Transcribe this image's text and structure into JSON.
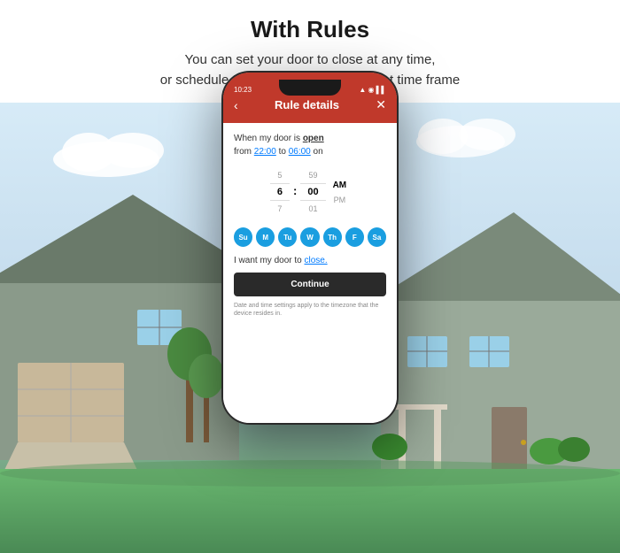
{
  "header": {
    "title": "With Rules",
    "subtitle_line1": "You can set your door to close at any time,",
    "subtitle_line2": "or schedule the door to close after a set time frame"
  },
  "phone": {
    "status_time": "10:23",
    "nav": {
      "back_icon": "‹",
      "close_icon": "✕"
    },
    "screen_title": "Rule details",
    "rule_text_1": "When my door is ",
    "rule_open": "open",
    "rule_text_2": "from ",
    "rule_from": "22:00",
    "rule_text_3": " to ",
    "rule_to": "06:00",
    "rule_text_4": " on",
    "time_picker": {
      "hour_above": "5",
      "hour_selected": "6",
      "hour_below": "7",
      "minute_above": "59",
      "minute_selected": "00",
      "minute_below": "01",
      "period_selected": "AM",
      "period_below": "PM"
    },
    "days": [
      "Su",
      "M",
      "Tu",
      "W",
      "Th",
      "F",
      "Sa"
    ],
    "door_action_text": "I want my door to ",
    "door_action_word": "close.",
    "continue_button": "Continue",
    "disclaimer": "Date and time settings apply to the timezone that the device resides in."
  }
}
